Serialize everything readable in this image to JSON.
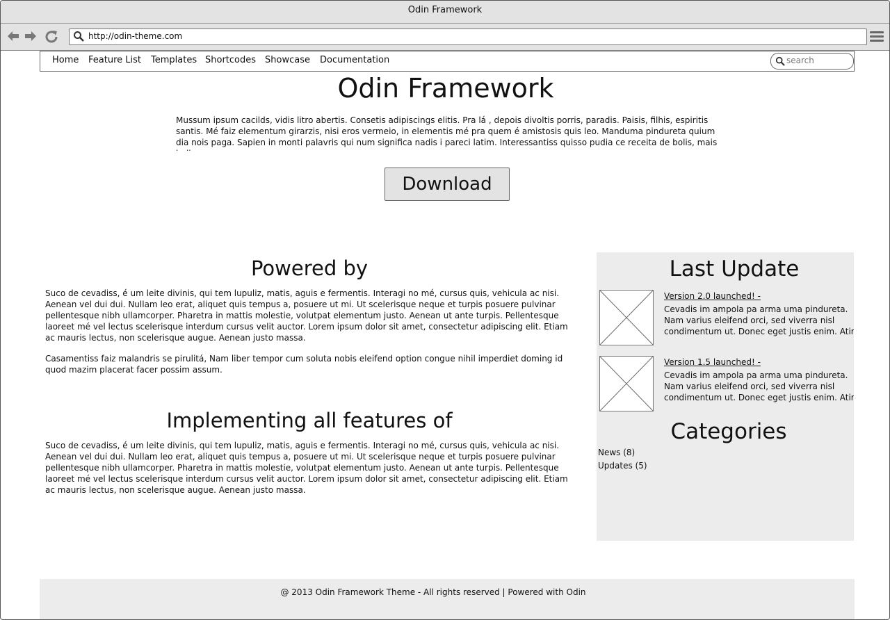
{
  "window": {
    "title": "Odin Framework"
  },
  "browser": {
    "url": "http://odin-theme.com"
  },
  "nav": {
    "items": [
      "Home",
      "Feature List",
      "Templates",
      "Shortcodes",
      "Showcase",
      "Documentation"
    ],
    "search_placeholder": "search"
  },
  "hero": {
    "title": "Odin Framework",
    "text": "Mussum ipsum cacilds, vidis litro abertis. Consetis adipiscings elitis. Pra lá , depois divoltis porris, paradis. Paisis, filhis, espiritis santis. Mé faiz elementum girarzis, nisi eros vermeio, in elementis mé pra quem é amistosis quis leo. Manduma pindureta quium dia nois paga. Sapien in monti palavris qui num significa nadis i pareci latim. Interessantiss quisso pudia ce receita de bolis, mais bolis",
    "download_label": "Download"
  },
  "powered": {
    "title": "Powered by",
    "p1": "Suco de cevadiss, é um leite divinis, qui tem lupuliz, matis, aguis e fermentis. Interagi no mé, cursus quis, vehicula ac nisi. Aenean vel dui dui. Nullam leo erat, aliquet quis tempus a, posuere ut mi. Ut scelerisque neque et turpis posuere pulvinar pellentesque nibh ullamcorper. Pharetra in mattis molestie, volutpat elementum justo. Aenean ut ante turpis. Pellentesque laoreet mé vel lectus scelerisque interdum cursus velit auctor. Lorem ipsum dolor sit amet, consectetur adipiscing elit. Etiam ac mauris lectus, non scelerisque augue. Aenean justo massa.",
    "p2": "Casamentiss faiz malandris se pirulitá, Nam liber tempor cum soluta nobis eleifend option congue nihil imperdiet doming id quod mazim placerat facer possim assum."
  },
  "features": {
    "title": "Implementing all features of",
    "p1": "Suco de cevadiss, é um leite divinis, qui tem lupuliz, matis, aguis e fermentis. Interagi no mé, cursus quis, vehicula ac nisi. Aenean vel dui dui. Nullam leo erat, aliquet quis tempus a, posuere ut mi. Ut scelerisque neque et turpis posuere pulvinar pellentesque nibh ullamcorper. Pharetra in mattis molestie, volutpat elementum justo. Aenean ut ante turpis. Pellentesque laoreet mé vel lectus scelerisque interdum cursus velit auctor. Lorem ipsum dolor sit amet, consectetur adipiscing elit. Etiam ac mauris lectus, non scelerisque augue. Aenean justo massa."
  },
  "sidebar": {
    "updates_title": "Last Update",
    "updates": [
      {
        "link": "Version 2.0 launched! -",
        "lines": [
          "Cevadis im ampola pa arma uma pindureta.",
          "Nam varius eleifend orci, sed viverra nisl",
          "condimentum ut. Donec eget justis enim. Atirei"
        ]
      },
      {
        "link": "Version 1.5 launched! -",
        "lines": [
          "Cevadis im ampola pa arma uma pindureta.",
          "Nam varius eleifend orci, sed viverra nisl",
          "condimentum ut. Donec eget justis enim. Atirei"
        ]
      }
    ],
    "categories_title": "Categories",
    "categories": [
      "News (8)",
      "Updates (5)"
    ]
  },
  "footer": {
    "text": "@ 2013 Odin Framework Theme - All rights reserved | Powered with Odin"
  }
}
